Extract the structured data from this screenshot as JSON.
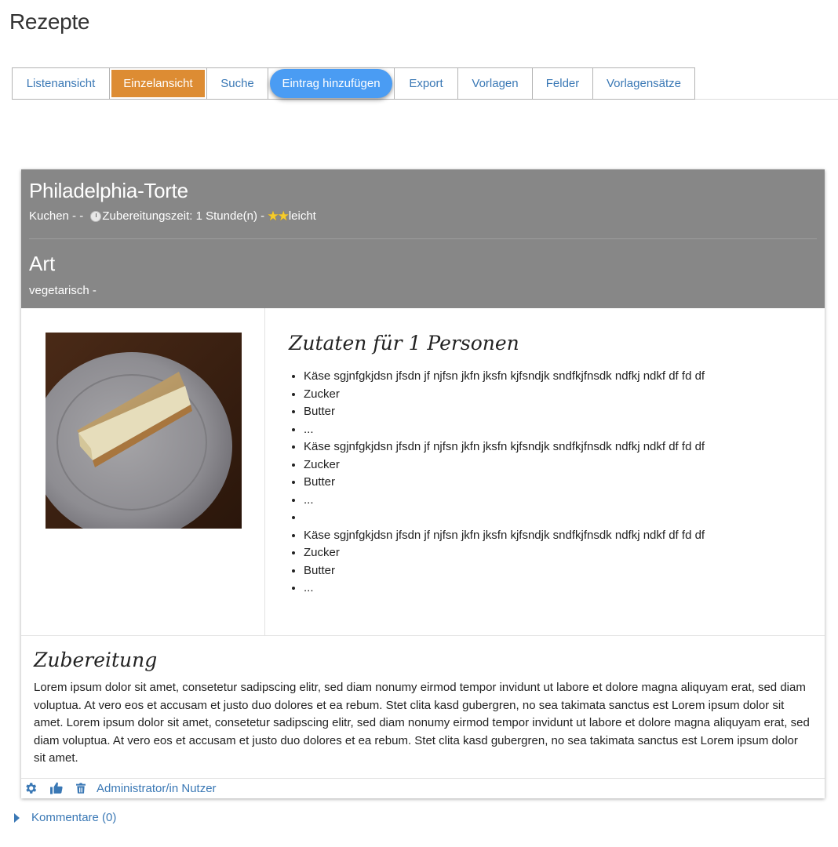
{
  "page": {
    "title": "Rezepte"
  },
  "tabs": [
    {
      "label": "Listenansicht"
    },
    {
      "label": "Einzelansicht"
    },
    {
      "label": "Suche"
    },
    {
      "label": "Eintrag hinzufügen"
    },
    {
      "label": "Export"
    },
    {
      "label": "Vorlagen"
    },
    {
      "label": "Felder"
    },
    {
      "label": "Vorlagensätze"
    }
  ],
  "recipe": {
    "title": "Philadelphia-Torte",
    "meta_prefix": "Kuchen - - ",
    "meta_prep": "Zubereitungszeit: 1 Stunde(n) - ",
    "meta_difficulty": "leicht",
    "stars": 2,
    "type_heading": "Art",
    "type_values": "vegetarisch -",
    "image_icon": "cake-photo",
    "ingredients_heading": "Zutaten für 1 Personen",
    "ingredients": [
      "Käse sgjnfgkjdsn jfsdn jf njfsn jkfn jksfn kjfsndjk sndfkjfnsdk ndfkj ndkf df fd df",
      "Zucker",
      "Butter",
      "...",
      "Käse sgjnfgkjdsn jfsdn jf njfsn jkfn jksfn kjfsndjk sndfkjfnsdk ndfkj ndkf df fd df",
      "Zucker",
      "Butter",
      "...",
      "",
      "Käse sgjnfgkjdsn jfsdn jf njfsn jkfn jksfn kjfsndjk sndfkjfnsdk ndfkj ndkf df fd df",
      "Zucker",
      "Butter",
      "..."
    ],
    "prep_heading": "Zubereitung",
    "prep_text": "Lorem ipsum dolor sit amet, consetetur sadipscing elitr, sed diam nonumy eirmod tempor invidunt ut labore et dolore magna aliquyam erat, sed diam voluptua. At vero eos et accusam et justo duo dolores et ea rebum. Stet clita kasd gubergren, no sea takimata sanctus est Lorem ipsum dolor sit amet. Lorem ipsum dolor sit amet, consetetur sadipscing elitr, sed diam nonumy eirmod tempor invidunt ut labore et dolore magna aliquyam erat, sed diam voluptua. At vero eos et accusam et justo duo dolores et ea rebum. Stet clita kasd gubergren, no sea takimata sanctus est Lorem ipsum dolor sit amet."
  },
  "footer": {
    "icons": [
      "gear-icon",
      "thumbs-up-icon",
      "trash-icon"
    ],
    "author": "Administrator/in Nutzer"
  },
  "comments": {
    "label": "Kommentare (0)"
  },
  "colors": {
    "active_tab": "#dd8c33",
    "pill": "#4a9cf3",
    "link": "#3a78b5",
    "header_bg": "#878787"
  }
}
